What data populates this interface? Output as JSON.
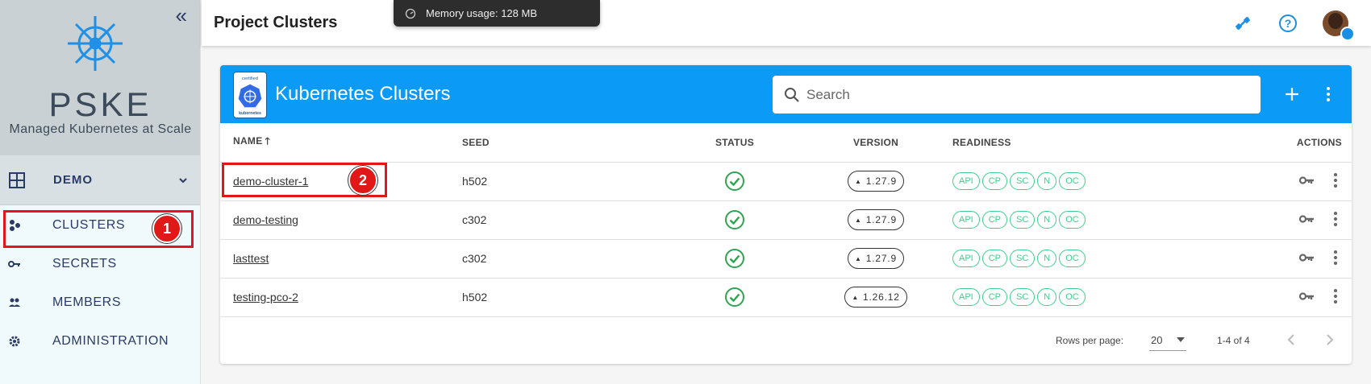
{
  "sidebar": {
    "brand_name": "PSKE",
    "brand_tagline": "Managed Kubernetes at Scale",
    "project": "DEMO",
    "items": [
      {
        "label": "CLUSTERS",
        "icon": "clusters-icon"
      },
      {
        "label": "SECRETS",
        "icon": "key-icon"
      },
      {
        "label": "MEMBERS",
        "icon": "members-icon"
      },
      {
        "label": "ADMINISTRATION",
        "icon": "gear-icon"
      }
    ]
  },
  "topbar": {
    "title": "Project Clusters"
  },
  "toast": {
    "text": "Memory usage: 128 MB"
  },
  "annotations": {
    "one": "1",
    "two": "2"
  },
  "card": {
    "title": "Kubernetes Clusters",
    "logo_top": "certified",
    "logo_bottom": "kubernetes",
    "search_placeholder": "Search"
  },
  "table": {
    "headers": {
      "name": "NAME",
      "seed": "SEED",
      "status": "STATUS",
      "version": "VERSION",
      "readiness": "READINESS",
      "actions": "ACTIONS"
    },
    "readiness_labels": [
      "API",
      "CP",
      "SC",
      "N",
      "OC"
    ],
    "rows": [
      {
        "name": "demo-cluster-1",
        "seed": "h502",
        "version": "1.27.9"
      },
      {
        "name": "demo-testing",
        "seed": "c302",
        "version": "1.27.9"
      },
      {
        "name": "lasttest",
        "seed": "c302",
        "version": "1.27.9"
      },
      {
        "name": "testing-pco-2",
        "seed": "h502",
        "version": "1.26.12"
      }
    ]
  },
  "footer": {
    "rows_label": "Rows per page:",
    "rows_value": "20",
    "range": "1-4 of 4"
  },
  "colors": {
    "primary": "#0b9af5",
    "ready": "#3ccf8a",
    "annotation": "#e01818",
    "nav": "#2a3b66"
  }
}
